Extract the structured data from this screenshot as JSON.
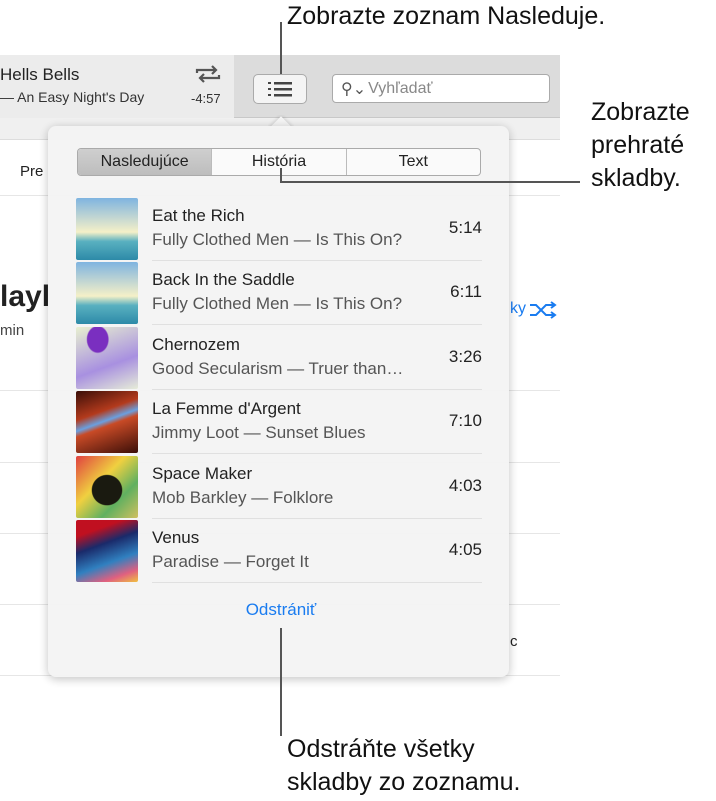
{
  "annotations": {
    "top": "Zobrazte zoznam Nasleduje.",
    "right": [
      "Zobrazte",
      "prehraté",
      "skladby."
    ],
    "bottom": [
      "Odstráňte všetky",
      "skladby zo zoznamu."
    ]
  },
  "now_playing": {
    "title": "Hells Bells",
    "subtitle": "— An Easy Night's Day",
    "time": "-4:57"
  },
  "search": {
    "placeholder": "Vyhľadať"
  },
  "background": {
    "nav": "Pre",
    "heading": "layl",
    "meta": "min",
    "shuffle": "ky",
    "extra": "c"
  },
  "popover": {
    "tabs": [
      {
        "label": "Nasledujúce",
        "active": true
      },
      {
        "label": "História"
      },
      {
        "label": "Text"
      }
    ],
    "songs": [
      {
        "title": "Eat the Rich",
        "subtitle": "Fully Clothed Men — Is This On?",
        "duration": "5:14",
        "art": "is-this-on"
      },
      {
        "title": "Back In the Saddle",
        "subtitle": "Fully Clothed Men — Is This On?",
        "duration": "6:11",
        "art": "is-this-on"
      },
      {
        "title": "Chernozem",
        "subtitle": "Good Secularism — Truer than…",
        "duration": "3:26",
        "art": "truer-than"
      },
      {
        "title": "La Femme d'Argent",
        "subtitle": "Jimmy Loot — Sunset Blues",
        "duration": "7:10",
        "art": "sunset-blues"
      },
      {
        "title": "Space Maker",
        "subtitle": "Mob Barkley — Folklore",
        "duration": "4:03",
        "art": "folklore"
      },
      {
        "title": "Venus",
        "subtitle": "Paradise — Forget It",
        "duration": "4:05",
        "art": "forget-it"
      }
    ],
    "clear_label": "Odstrániť"
  },
  "colors": {
    "accent": "#1a7cf0"
  }
}
